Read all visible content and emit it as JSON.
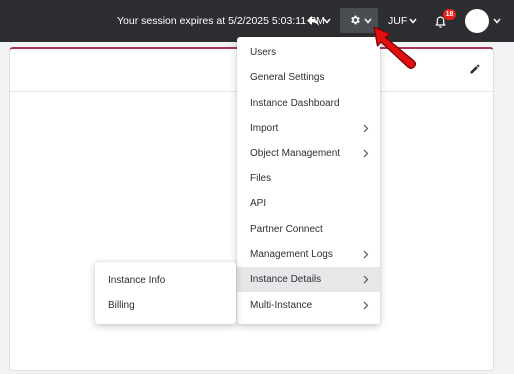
{
  "topbar": {
    "session_text": "Your session expires at 5/2/2025 5:03:11 PM",
    "user_initials": "JUF",
    "notification_count": "18",
    "icons": {
      "back": "reply-icon",
      "settings": "gear-icon",
      "notifications": "bell-icon",
      "avatar": "avatar"
    }
  },
  "panel": {
    "edit_icon": "pencil-icon"
  },
  "settings_menu": {
    "items": [
      {
        "label": "Users",
        "has_submenu": false
      },
      {
        "label": "General Settings",
        "has_submenu": false
      },
      {
        "label": "Instance Dashboard",
        "has_submenu": false
      },
      {
        "label": "Import",
        "has_submenu": true
      },
      {
        "label": "Object Management",
        "has_submenu": true
      },
      {
        "label": "Files",
        "has_submenu": false
      },
      {
        "label": "API",
        "has_submenu": false
      },
      {
        "label": "Partner Connect",
        "has_submenu": false
      },
      {
        "label": "Management Logs",
        "has_submenu": true
      },
      {
        "label": "Instance Details",
        "has_submenu": true,
        "active": true
      },
      {
        "label": "Multi-Instance",
        "has_submenu": true
      }
    ]
  },
  "instance_details_submenu": {
    "items": [
      {
        "label": "Instance Info"
      },
      {
        "label": "Billing"
      }
    ]
  },
  "colors": {
    "topbar_bg": "#2c2e31",
    "accent": "#a9345b",
    "badge": "#e2231a",
    "pointer_arrow": "#e01010"
  }
}
